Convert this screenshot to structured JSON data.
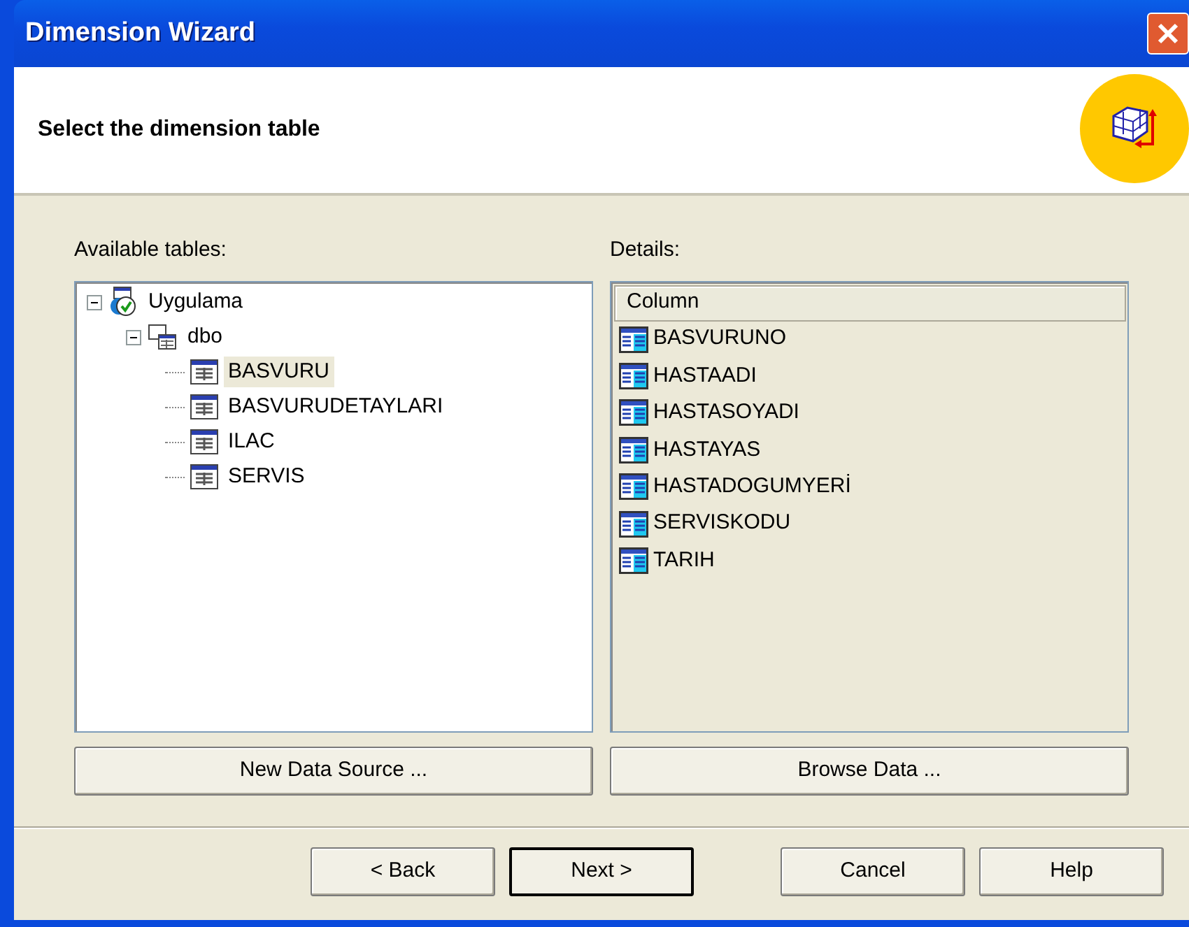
{
  "window": {
    "title": "Dimension Wizard"
  },
  "header": {
    "title": "Select the dimension table"
  },
  "available_tables": {
    "label": "Available tables:",
    "tree": [
      {
        "label": "Uygulama",
        "kind": "datasource",
        "expanded": true,
        "selected": false,
        "children": [
          {
            "label": "dbo",
            "kind": "schema",
            "expanded": true,
            "selected": false,
            "children": [
              {
                "label": "BASVURU",
                "kind": "table",
                "selected": true
              },
              {
                "label": "BASVURUDETAYLARI",
                "kind": "table",
                "selected": false
              },
              {
                "label": "ILAC",
                "kind": "table",
                "selected": false
              },
              {
                "label": "SERVIS",
                "kind": "table",
                "selected": false
              }
            ]
          }
        ]
      }
    ]
  },
  "details": {
    "label": "Details:",
    "column_header": "Column",
    "rows": [
      "BASVURUNO",
      "HASTAADI",
      "HASTASOYADI",
      "HASTAYAS",
      "HASTADOGUMYERİ",
      "SERVISKODU",
      "TARIH"
    ]
  },
  "panel_buttons": [
    "New Data Source ...",
    "Browse Data ..."
  ],
  "footer_buttons": [
    {
      "label": "< Back",
      "default": false
    },
    {
      "label": "Next >",
      "default": true
    },
    {
      "label": "Cancel",
      "default": false
    },
    {
      "label": "Help",
      "default": false
    }
  ]
}
